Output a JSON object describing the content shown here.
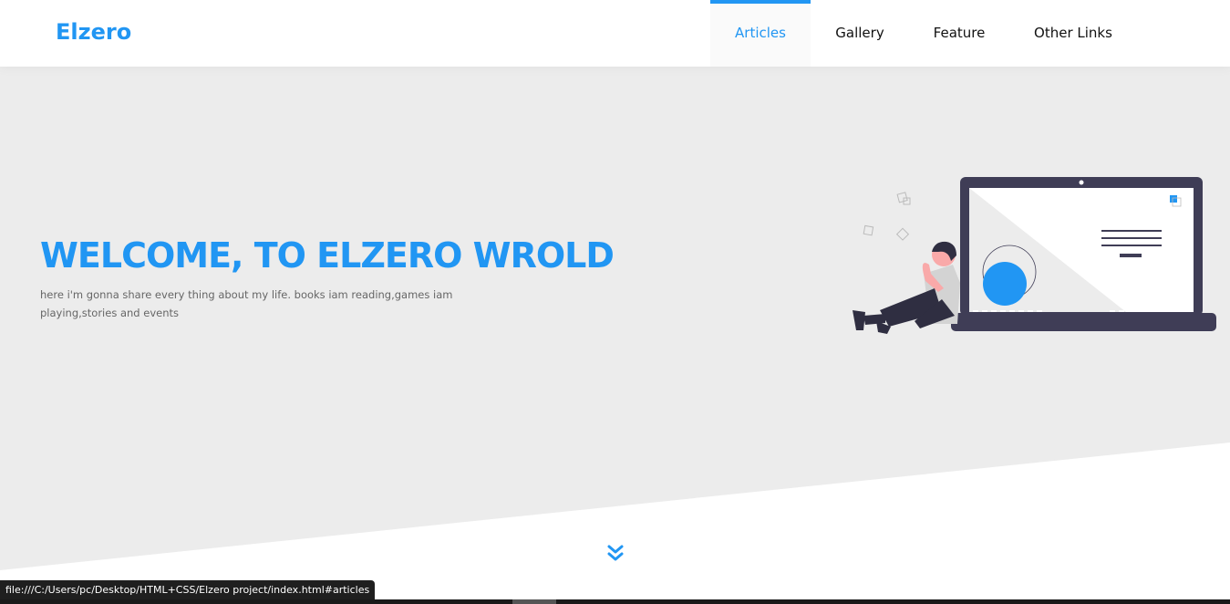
{
  "header": {
    "logo": "Elzero",
    "nav": [
      {
        "label": "Articles",
        "active": true
      },
      {
        "label": "Gallery",
        "active": false
      },
      {
        "label": "Feature",
        "active": false
      },
      {
        "label": "Other Links",
        "active": false
      }
    ]
  },
  "landing": {
    "title": "WELCOME, TO ELZERO WROLD",
    "text": "here i'm gonna share every thing about my life. books iam reading,games iam playing,stories and events",
    "down_icon": "double-chevron-down-icon"
  },
  "status": {
    "url": "file:///C:/Users/pc/Desktop/HTML+CSS/Elzero project/index.html#articles"
  },
  "colors": {
    "accent": "#2196f3",
    "landing_bg": "#ececec",
    "dark": "#3f3d56"
  }
}
